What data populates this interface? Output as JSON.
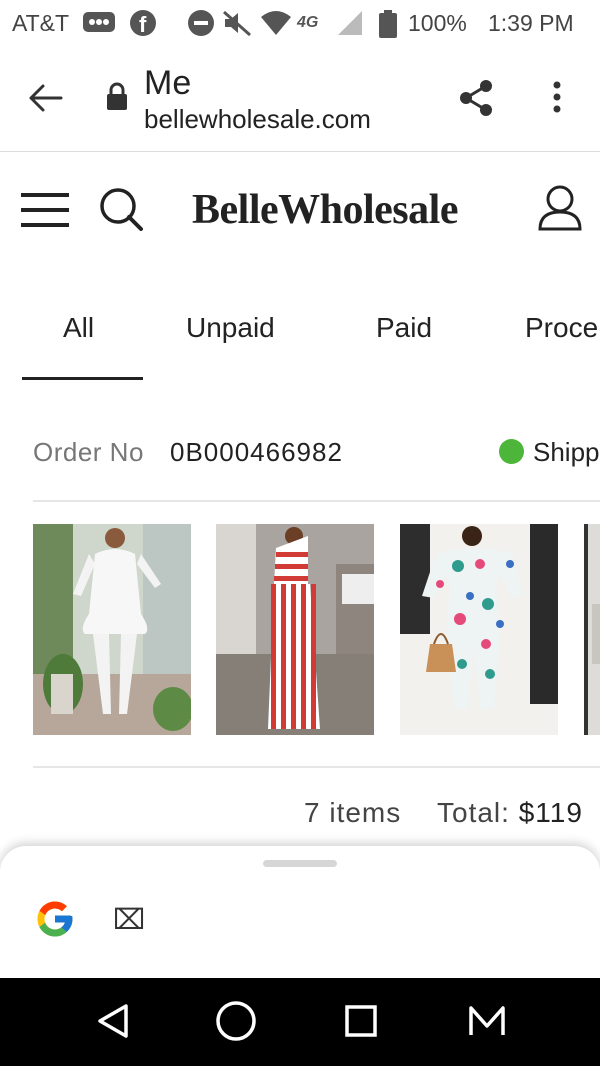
{
  "status_bar": {
    "carrier": "AT&T",
    "network": "4G",
    "battery": "100%",
    "time": "1:39 PM",
    "icons": [
      "voicemail-icon",
      "facebook-icon",
      "do-not-disturb-icon",
      "mute-icon",
      "wifi-icon",
      "signal-icon",
      "battery-icon"
    ]
  },
  "browser": {
    "title": "Me",
    "url": "bellewholesale.com",
    "icons": [
      "back-arrow-icon",
      "lock-icon",
      "share-icon",
      "more-vert-icon"
    ]
  },
  "site": {
    "logo": "BelleWholesale",
    "icons": [
      "menu-icon",
      "search-icon",
      "account-icon"
    ]
  },
  "tabs": [
    "All",
    "Unpaid",
    "Paid",
    "Proce"
  ],
  "active_tab": "All",
  "order": {
    "label": "Order No",
    "number": "0B000466982",
    "status": "Shipp",
    "status_color": "#4cb53a",
    "product_images": [
      "white-peplum-pant-suit",
      "red-white-striped-jumpsuit",
      "floral-off-shoulder-jumpsuit",
      "partial-product-image"
    ],
    "items": "7 items",
    "total_label": "Total:",
    "total_value": "$119"
  },
  "sheet": {
    "icon": "google-icon",
    "glyph": "⌧"
  },
  "nav": {
    "icons": [
      "back-nav-icon",
      "home-nav-icon",
      "recents-nav-icon",
      "m-app-icon"
    ]
  }
}
